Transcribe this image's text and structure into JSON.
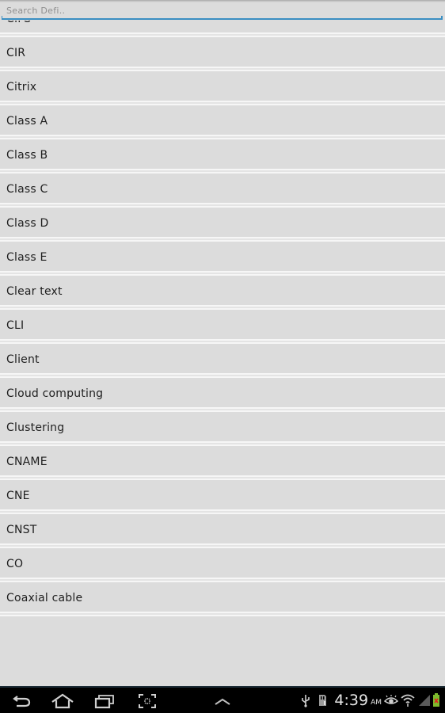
{
  "search": {
    "placeholder": "Search Defi..",
    "value": ""
  },
  "list": {
    "items": [
      {
        "label": "CIFS"
      },
      {
        "label": "CIR"
      },
      {
        "label": "Citrix"
      },
      {
        "label": "Class A"
      },
      {
        "label": "Class B"
      },
      {
        "label": "Class C"
      },
      {
        "label": "Class D"
      },
      {
        "label": "Class E"
      },
      {
        "label": "Clear text"
      },
      {
        "label": "CLI"
      },
      {
        "label": "Client"
      },
      {
        "label": "Cloud computing"
      },
      {
        "label": "Clustering"
      },
      {
        "label": "CNAME"
      },
      {
        "label": "CNE"
      },
      {
        "label": "CNST"
      },
      {
        "label": "CO"
      },
      {
        "label": "Coaxial cable"
      }
    ]
  },
  "navbar": {
    "buttons": [
      "back-icon",
      "home-icon",
      "recent-apps-icon",
      "screenshot-icon",
      "menu-up-icon"
    ],
    "status": {
      "icons": [
        "usb-icon",
        "sd-card-icon",
        "eye-icon",
        "wifi-icon",
        "signal-icon",
        "battery-icon"
      ],
      "time": "4:39",
      "ampm": "AM"
    }
  }
}
